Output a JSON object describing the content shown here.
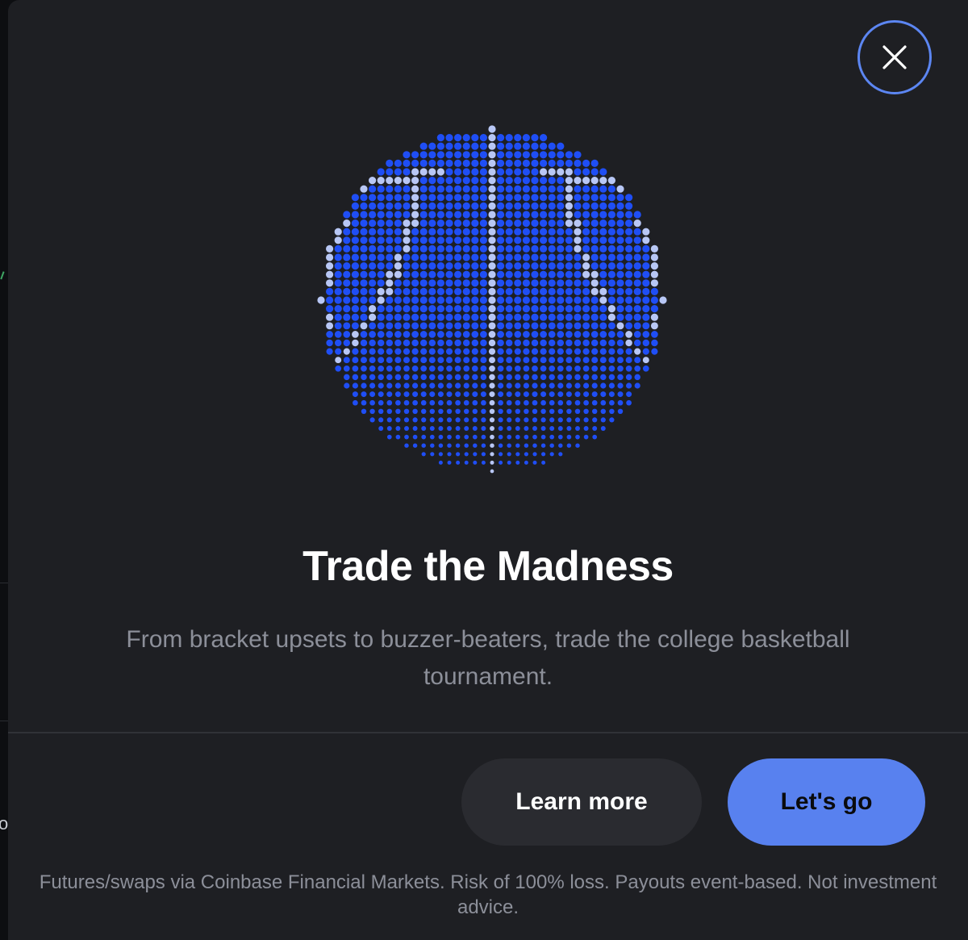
{
  "modal": {
    "close_icon": "close-icon",
    "illustration": "basketball-dot-matrix-icon",
    "title": "Trade the Madness",
    "subtitle": "From bracket upsets to buzzer-beaters, trade the college basketball tournament.",
    "learn_more_label": "Learn more",
    "lets_go_label": "Let's go",
    "disclaimer": "Futures/swaps via Coinbase Financial Markets. Risk of 100% loss. Payouts event-based. Not investment advice."
  },
  "backdrop": {
    "partial_glyph": "o"
  },
  "colors": {
    "modal_bg": "#1e1f23",
    "accent_blue": "#5881ef",
    "ball_blue": "#1f4ef5",
    "ball_seam": "#b8c7f5",
    "text_muted": "#8c8f99"
  }
}
